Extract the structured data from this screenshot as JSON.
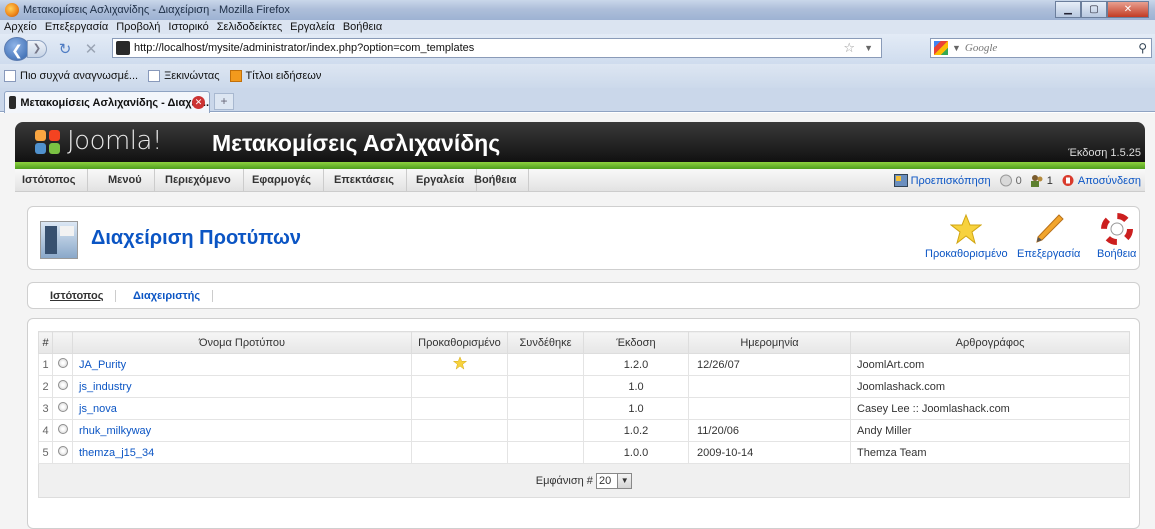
{
  "browser": {
    "window_title": "Μετακομίσεις Ασλιχανίδης - Διαχείριση - Mozilla Firefox",
    "menu": [
      "Αρχείο",
      "Επεξεργασία",
      "Προβολή",
      "Ιστορικό",
      "Σελιδοδείκτες",
      "Εργαλεία",
      "Βοήθεια"
    ],
    "url": "http://localhost/mysite/administrator/index.php?option=com_templates",
    "search_placeholder": "Google",
    "bookmarks": [
      "Πιο συχνά αναγνωσμέ...",
      "Ξεκινώντας",
      "Τίτλοι ειδήσεων"
    ],
    "tab_label": "Μετακομίσεις Ασλιχανίδης - Διαχεί..."
  },
  "joomla": {
    "logo_text": "Joomla!",
    "site_name": "Μετακομίσεις Ασλιχανίδης",
    "version": "Έκδοση 1.5.25",
    "menu": [
      "Ιστότοπος",
      "Μενού",
      "Περιεχόμενο",
      "Εφαρμογές",
      "Επεκτάσεις",
      "Εργαλεία",
      "Βοήθεια"
    ],
    "status": {
      "preview": "Προεπισκόπηση",
      "messages": "0",
      "users": "1",
      "logout": "Αποσύνδεση"
    },
    "page_title": "Διαχείριση Προτύπων",
    "toolbar": {
      "default": "Προκαθορισμένο",
      "edit": "Επεξεργασία",
      "help": "Βοήθεια"
    },
    "subnav": [
      "Ιστότοπος",
      "Διαχειριστής"
    ],
    "table": {
      "headers": [
        "#",
        "Όνομα Προτύπου",
        "Προκαθορισμένο",
        "Συνδέθηκε",
        "Έκδοση",
        "Ημερομηνία",
        "Αρθρογράφος"
      ],
      "rows": [
        {
          "num": "1",
          "name": "JA_Purity",
          "default": true,
          "version": "1.2.0",
          "date": "12/26/07",
          "author": "JoomlArt.com"
        },
        {
          "num": "2",
          "name": "js_industry",
          "default": false,
          "version": "1.0",
          "date": "",
          "author": "Joomlashack.com"
        },
        {
          "num": "3",
          "name": "js_nova",
          "default": false,
          "version": "1.0",
          "date": "",
          "author": "Casey Lee :: Joomlashack.com"
        },
        {
          "num": "4",
          "name": "rhuk_milkyway",
          "default": false,
          "version": "1.0.2",
          "date": "11/20/06",
          "author": "Andy Miller"
        },
        {
          "num": "5",
          "name": "themza_j15_34",
          "default": false,
          "version": "1.0.0",
          "date": "2009-10-14",
          "author": "Themza Team"
        }
      ],
      "display_label": "Εμφάνιση #",
      "display_value": "20"
    }
  }
}
